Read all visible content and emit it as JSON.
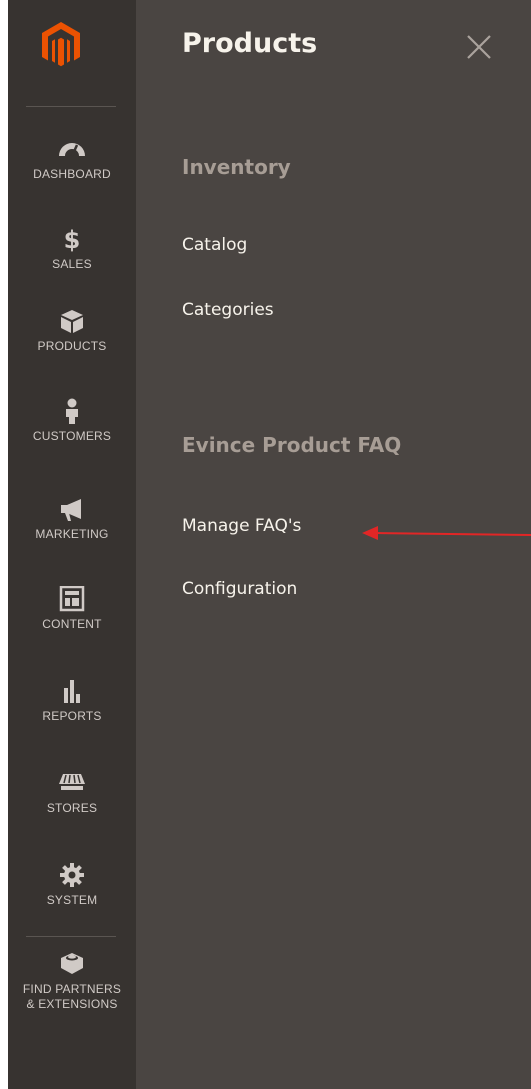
{
  "sidebar": {
    "logo": "magento-logo",
    "items": [
      {
        "label": "DASHBOARD",
        "icon": "speedometer-icon"
      },
      {
        "label": "SALES",
        "icon": "dollar-icon"
      },
      {
        "label": "PRODUCTS",
        "icon": "cube-icon"
      },
      {
        "label": "CUSTOMERS",
        "icon": "person-icon"
      },
      {
        "label": "MARKETING",
        "icon": "megaphone-icon"
      },
      {
        "label": "CONTENT",
        "icon": "layout-icon"
      },
      {
        "label": "REPORTS",
        "icon": "bar-chart-icon"
      },
      {
        "label": "STORES",
        "icon": "storefront-icon"
      },
      {
        "label": "SYSTEM",
        "icon": "gear-icon"
      },
      {
        "label": "FIND PARTNERS & EXTENSIONS",
        "icon": "lego-brick-icon"
      }
    ]
  },
  "panel": {
    "title": "Products",
    "sections": [
      {
        "title": "Inventory",
        "links": [
          "Catalog",
          "Categories"
        ]
      },
      {
        "title": "Evince Product FAQ",
        "links": [
          "Manage FAQ's",
          "Configuration"
        ]
      }
    ]
  },
  "colors": {
    "sidebar_bg": "#373330",
    "panel_bg": "#4a4542",
    "logo_orange": "#eb5202",
    "annotation_arrow": "#e22626"
  }
}
